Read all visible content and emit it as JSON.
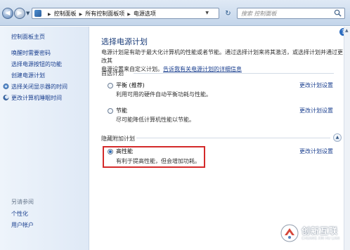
{
  "address_bar": {
    "crumbs": [
      "控制面板",
      "所有控制面板项",
      "电源选项"
    ],
    "search_placeholder": "搜索 控制面板"
  },
  "sidebar": {
    "home": "控制面板主页",
    "links": [
      "唤醒时需要密码",
      "选择电源按钮的功能",
      "创建电源计划",
      "选择关闭显示器的时间",
      "更改计算机睡眠时间"
    ],
    "see_also_title": "另请参阅",
    "see_also": [
      "个性化",
      "用户帐户"
    ]
  },
  "main": {
    "title": "选择电源计划",
    "desc_line1": "电源计划是有助于最大化计算机的性能或者节能。通过选择计划来将其激活，或选择计划并通过更改其",
    "desc_line2_prefix": "电源设置来自定义计划。",
    "desc_link": "告诉我有关电源计划的详细信息",
    "preferred_label": "首选计划",
    "hidden_label": "隐藏附加计划",
    "plans": [
      {
        "name": "平衡 (推荐)",
        "desc": "利用可用的硬件自动平衡功耗与性能。",
        "change": "更改计划设置",
        "selected": false
      },
      {
        "name": "节能",
        "desc": "尽可能降低计算机性能以节能。",
        "change": "更改计划设置",
        "selected": false
      },
      {
        "name": "高性能",
        "desc": "有利于提高性能，但会增加功耗。",
        "change": "更改计划设置",
        "selected": true
      }
    ]
  },
  "watermark": {
    "cn": "创新互联",
    "en": "CHUANG XIN HU LIAN"
  },
  "colors": {
    "highlight": "#d42a2a",
    "link": "#1a3f8f",
    "title": "#1b3d7a"
  }
}
